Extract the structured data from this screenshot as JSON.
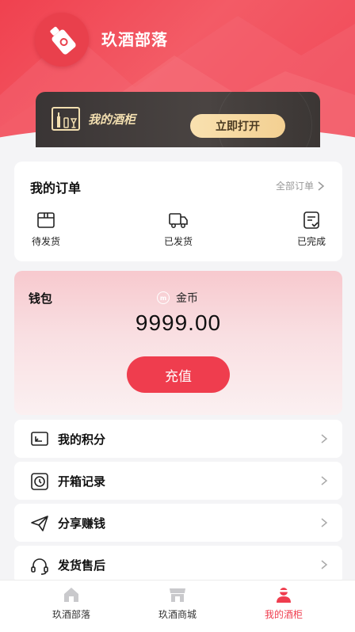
{
  "header": {
    "title": "玖酒部落"
  },
  "cabinet": {
    "label": "我的酒柜",
    "open_button": "立即打开"
  },
  "orders": {
    "title": "我的订单",
    "all_link": "全部订单",
    "items": [
      {
        "label": "待发货",
        "icon": "box-icon"
      },
      {
        "label": "已发货",
        "icon": "truck-icon"
      },
      {
        "label": "已完成",
        "icon": "check-doc-icon"
      }
    ]
  },
  "wallet": {
    "title": "钱包",
    "coin_label": "金币",
    "balance": "9999.00",
    "recharge_button": "充值"
  },
  "menu": [
    {
      "label": "我的积分",
      "icon": "points-icon"
    },
    {
      "label": "开箱记录",
      "icon": "clock-icon"
    },
    {
      "label": "分享赚钱",
      "icon": "send-icon"
    },
    {
      "label": "发货售后",
      "icon": "headset-icon"
    }
  ],
  "tabbar": {
    "items": [
      {
        "label": "玖酒部落",
        "icon": "home-icon",
        "active": false
      },
      {
        "label": "玖酒商城",
        "icon": "shop-icon",
        "active": false
      },
      {
        "label": "我的酒柜",
        "icon": "user-icon",
        "active": true
      }
    ]
  },
  "colors": {
    "primary": "#ef3d4e",
    "gold": "#f3d092",
    "dark": "#3a3535"
  }
}
